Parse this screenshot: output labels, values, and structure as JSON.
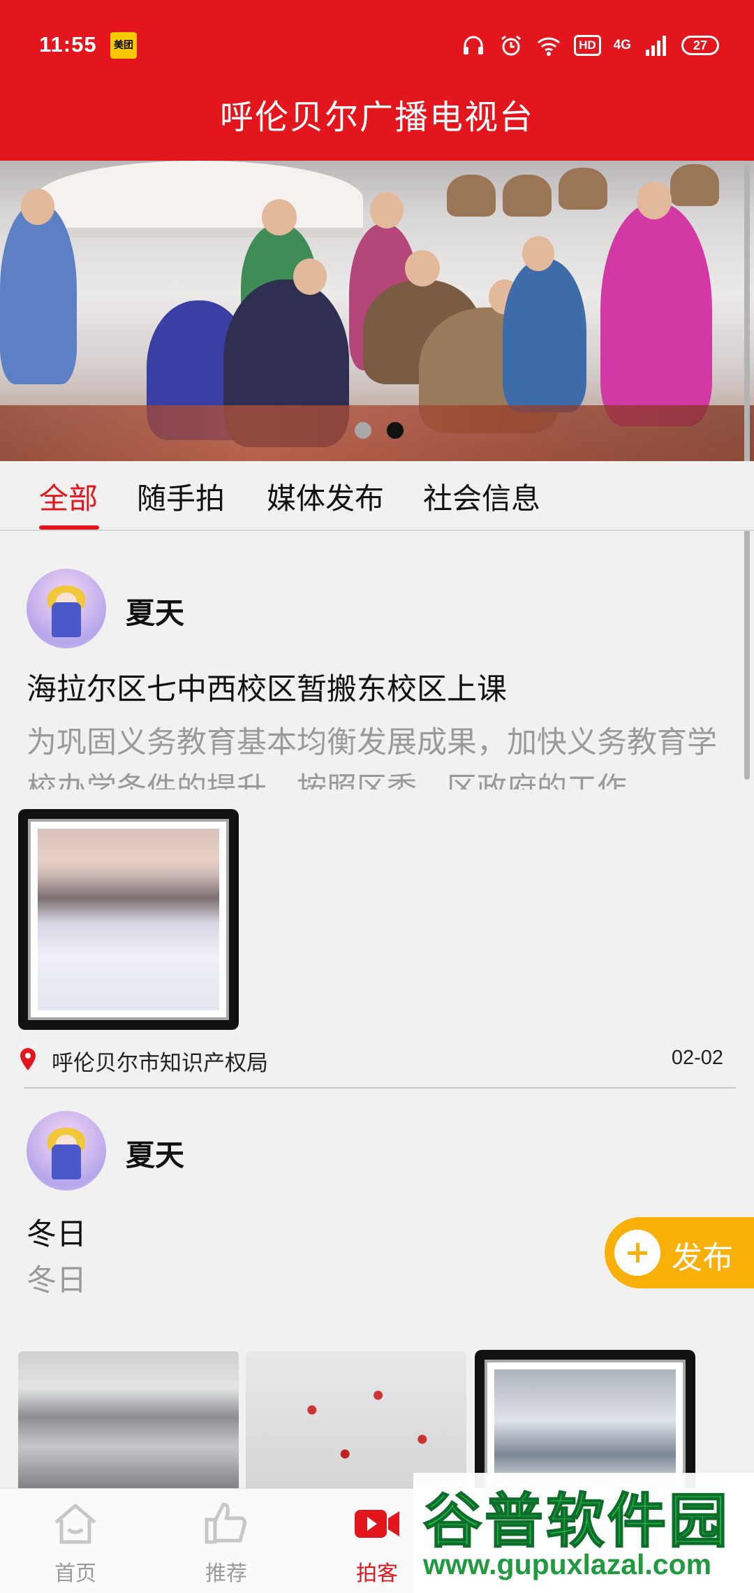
{
  "status_bar": {
    "time": "11:55",
    "app_badge": "美团",
    "hd_label": "HD",
    "network_label": "4G",
    "battery": "27"
  },
  "header": {
    "title": "呼伦贝尔广播电视台"
  },
  "banner": {
    "page_count": 2,
    "current_page": 1
  },
  "tabs": [
    {
      "label": "全部",
      "active": true
    },
    {
      "label": "随手拍",
      "active": false
    },
    {
      "label": "媒体发布",
      "active": false
    },
    {
      "label": "社会信息",
      "active": false
    }
  ],
  "posts": [
    {
      "username": "夏天",
      "title": "海拉尔区七中西校区暂搬东校区上课",
      "body": "为巩固义务教育基本均衡发展成果，加快义务教育学校办学条件的提升，按照区委、区政府的工作…",
      "location": "呼伦贝尔市知识产权局",
      "date": "02-02"
    },
    {
      "username": "夏天",
      "title": "冬日",
      "body": "冬日"
    }
  ],
  "fab": {
    "label": "发布"
  },
  "bottom_nav": [
    {
      "label": "首页",
      "icon": "home-icon",
      "active": false
    },
    {
      "label": "推荐",
      "icon": "thumbs-up-icon",
      "active": false
    },
    {
      "label": "拍客",
      "icon": "video-camera-icon",
      "active": true
    }
  ],
  "watermark": {
    "title": "谷普软件园",
    "url": "www.gupuxlazal.com"
  },
  "colors": {
    "brand_red": "#e4161d",
    "fab_orange": "#f9b10a",
    "background": "#f1f1f1"
  }
}
